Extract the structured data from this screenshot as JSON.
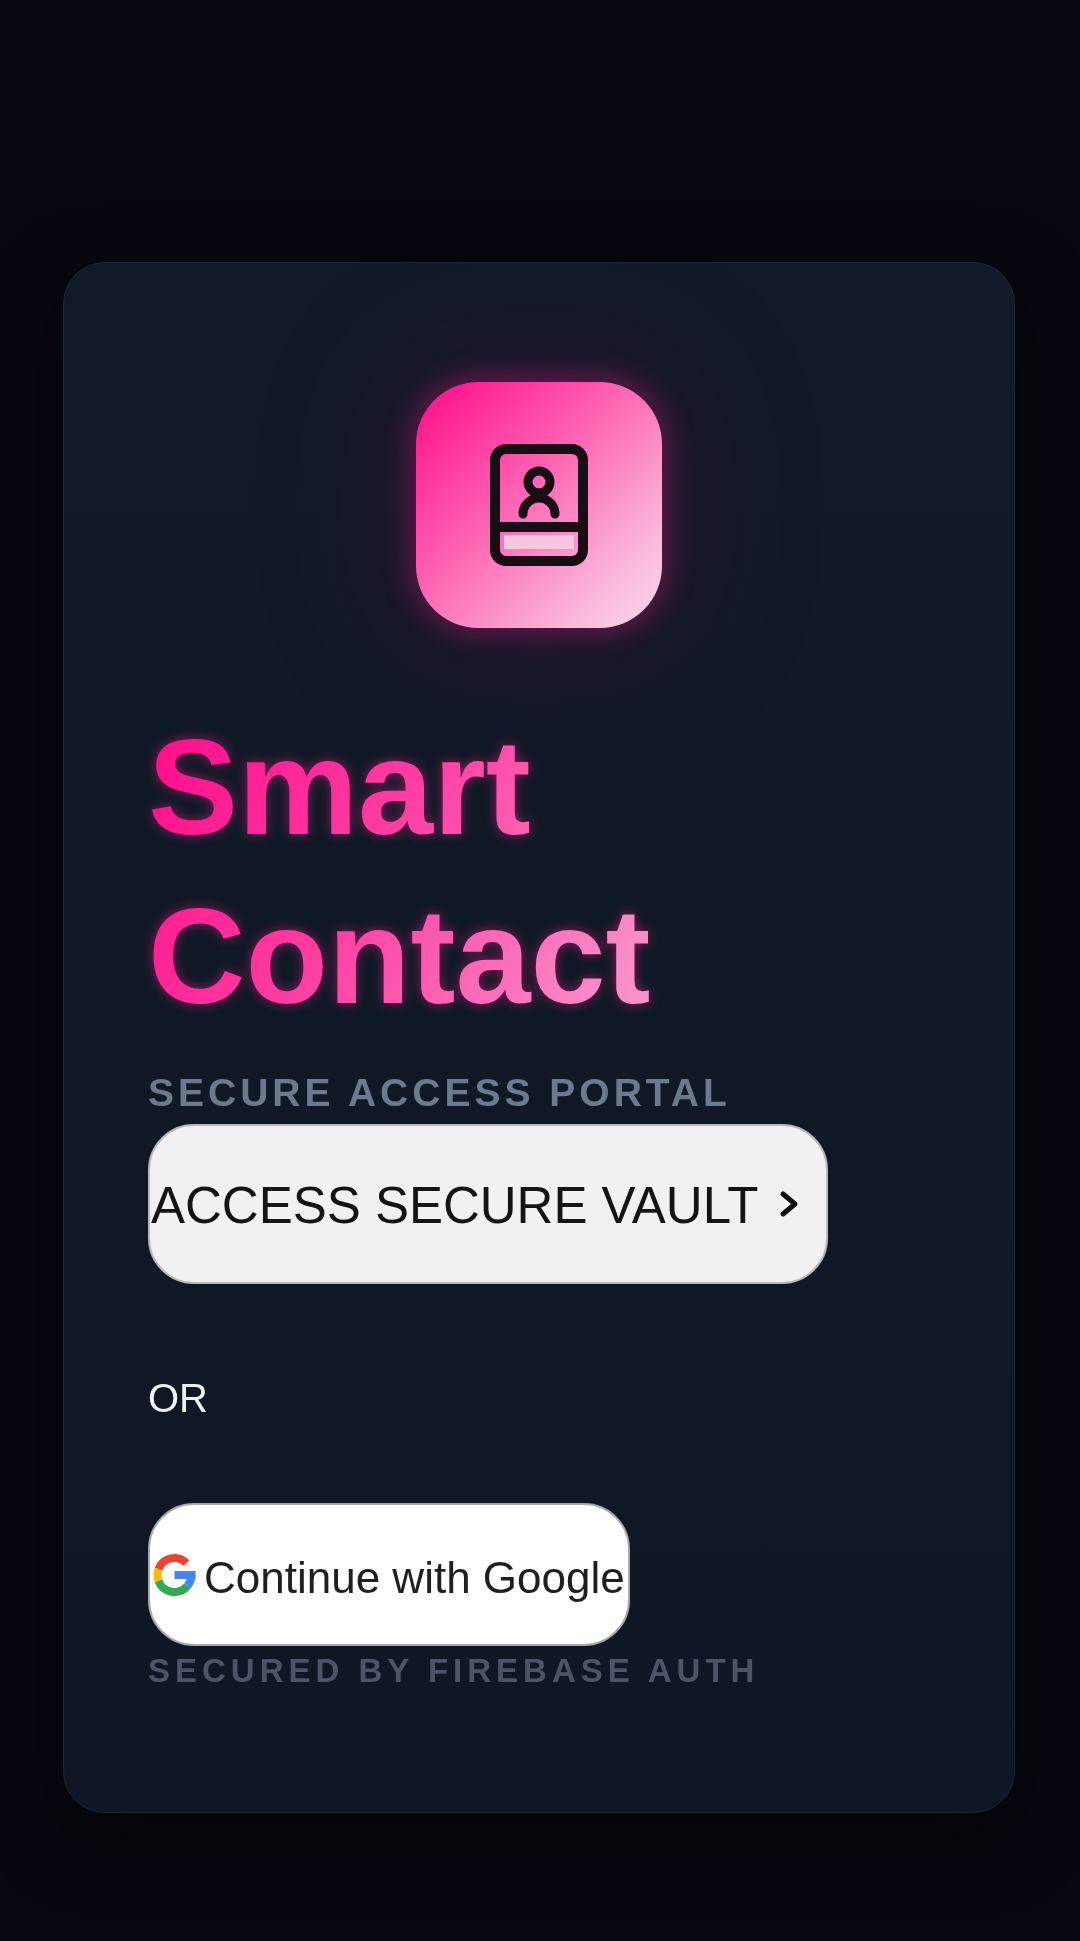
{
  "title": "Smart Contact",
  "subtitle": "SECURE ACCESS PORTAL",
  "primary_button": {
    "label": "ACCESS SECURE VAULT"
  },
  "separator": "OR",
  "google_button": {
    "label": "Continue with Google"
  },
  "footer": "SECURED BY FIREBASE AUTH"
}
